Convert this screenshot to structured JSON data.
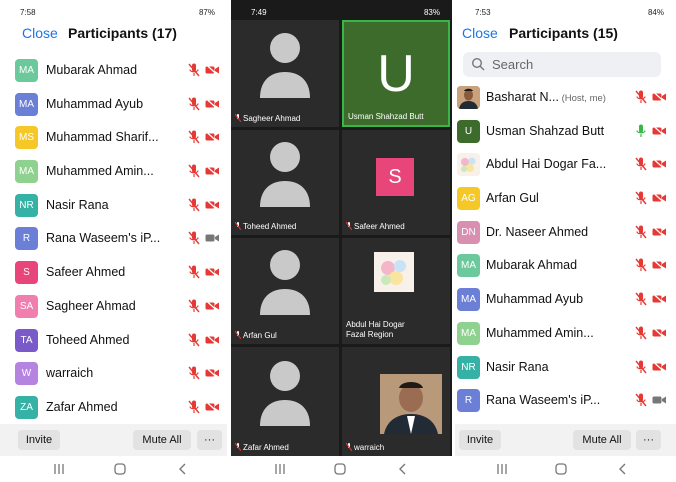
{
  "colors": {
    "accent": "#1e73e8",
    "muted_red": "#e53935",
    "unmuted_green": "#3ab54a",
    "cam_gray": "#777777"
  },
  "panel1": {
    "status_time": "7:58",
    "status_sys": "87%",
    "close_label": "Close",
    "title": "Participants (17)",
    "participants": [
      {
        "initials": "MA",
        "name": "Mubarak Ahmad",
        "color": "#6cc99b",
        "mic": "muted",
        "cam": "off"
      },
      {
        "initials": "MA",
        "name": "Muhammad Ayub",
        "color": "#6b7fd7",
        "mic": "muted",
        "cam": "off"
      },
      {
        "initials": "MS",
        "name": "Muhammad Sharif...",
        "color": "#f5c828",
        "mic": "muted",
        "cam": "off"
      },
      {
        "initials": "MA",
        "name": "Muhammed Amin...",
        "color": "#8fd18f",
        "mic": "muted",
        "cam": "off"
      },
      {
        "initials": "NR",
        "name": "Nasir Rana",
        "color": "#35b2a5",
        "mic": "muted",
        "cam": "off"
      },
      {
        "initials": "R",
        "name": "Rana Waseem's iP...",
        "color": "#6b7fd7",
        "mic": "muted",
        "cam": "on"
      },
      {
        "initials": "S",
        "name": "Safeer Ahmed",
        "color": "#e8457a",
        "mic": "muted",
        "cam": "off"
      },
      {
        "initials": "SA",
        "name": "Sagheer Ahmad",
        "color": "#f07fb0",
        "mic": "muted",
        "cam": "off"
      },
      {
        "initials": "TA",
        "name": "Toheed Ahmed",
        "color": "#7a59c9",
        "mic": "muted",
        "cam": "off"
      },
      {
        "initials": "W",
        "name": "warraich",
        "color": "#b584e0",
        "mic": "muted",
        "cam": "off"
      },
      {
        "initials": "ZA",
        "name": "Zafar Ahmed",
        "color": "#35b2a5",
        "mic": "muted",
        "cam": "off"
      }
    ],
    "invite_label": "Invite",
    "mute_all_label": "Mute All",
    "more_label": "···"
  },
  "panel2": {
    "status_time": "7:49",
    "status_sys": "83%",
    "tiles": [
      {
        "name": "Sagheer Ahmad",
        "kind": "silhouette",
        "muted": true
      },
      {
        "name": "Usman Shahzad Butt",
        "kind": "letter",
        "letter": "U",
        "bg": "#3c6b2c",
        "active": true,
        "muted": false
      },
      {
        "name": "Toheed Ahmed",
        "kind": "silhouette",
        "muted": true
      },
      {
        "name": "Safeer Ahmed",
        "kind": "square",
        "letter": "S",
        "muted": true
      },
      {
        "name": "Arfan Gul",
        "kind": "silhouette",
        "muted": true
      },
      {
        "name": "Abdul Hai Dogar\nFazal Region",
        "kind": "flower",
        "muted": true
      },
      {
        "name": "Zafar Ahmed",
        "kind": "silhouette",
        "muted": true
      },
      {
        "name": "warraich",
        "kind": "photo",
        "muted": true
      }
    ]
  },
  "panel3": {
    "status_time": "7:53",
    "status_sys": "84%",
    "close_label": "Close",
    "title": "Participants (15)",
    "search_placeholder": "Search",
    "participants": [
      {
        "initials": "",
        "name": "Basharat N...",
        "sub": "(Host, me)",
        "color": "#8a6a4a",
        "photo": true,
        "mic": "muted",
        "cam": "off"
      },
      {
        "initials": "U",
        "name": "Usman Shahzad Butt",
        "color": "#3c6b2c",
        "mic": "on",
        "cam": "off"
      },
      {
        "initials": "",
        "name": "Abdul Hai Dogar Fa...",
        "color": "#f3e7e7",
        "flower": true,
        "mic": "muted",
        "cam": "off"
      },
      {
        "initials": "AG",
        "name": "Arfan Gul",
        "color": "#f5c828",
        "mic": "muted",
        "cam": "off"
      },
      {
        "initials": "DN",
        "name": "Dr. Naseer Ahmed",
        "color": "#d98fb0",
        "mic": "muted",
        "cam": "off"
      },
      {
        "initials": "MA",
        "name": "Mubarak Ahmad",
        "color": "#6cc99b",
        "mic": "muted",
        "cam": "off"
      },
      {
        "initials": "MA",
        "name": "Muhammad Ayub",
        "color": "#6b7fd7",
        "mic": "muted",
        "cam": "off"
      },
      {
        "initials": "MA",
        "name": "Muhammed Amin...",
        "color": "#8fd18f",
        "mic": "muted",
        "cam": "off"
      },
      {
        "initials": "NR",
        "name": "Nasir Rana",
        "color": "#35b2a5",
        "mic": "muted",
        "cam": "off"
      },
      {
        "initials": "R",
        "name": "Rana Waseem's iP...",
        "color": "#6b7fd7",
        "mic": "muted",
        "cam": "on"
      }
    ],
    "invite_label": "Invite",
    "mute_all_label": "Mute All",
    "more_label": "···"
  }
}
